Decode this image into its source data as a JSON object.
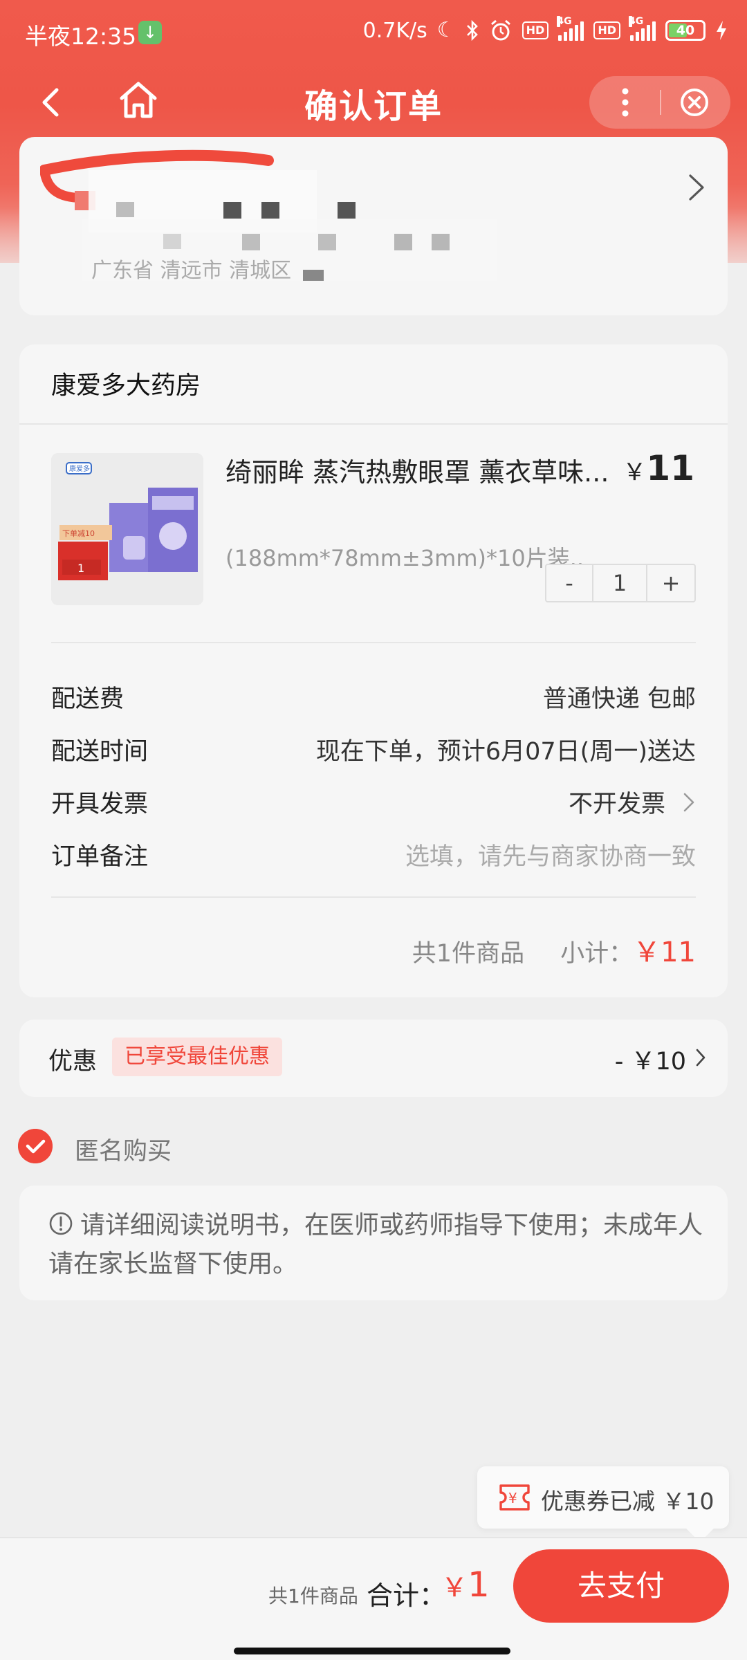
{
  "status_bar": {
    "time": "半夜12:35",
    "network_speed": "0.7K/s",
    "battery": "40",
    "icons": [
      "download-icon",
      "moon-icon",
      "bluetooth-icon",
      "alarm-icon",
      "hd-icon",
      "signal-4g-icon",
      "hd-icon",
      "signal-4g-icon",
      "battery-icon",
      "charging-icon"
    ]
  },
  "nav": {
    "title": "确认订单",
    "icons": [
      "back-icon",
      "home-icon",
      "more-icon",
      "close-icon"
    ]
  },
  "address": {
    "line": "广东省 清远市 清城区"
  },
  "shop": {
    "name": "康爱多大药房",
    "product": {
      "title": "绮丽眸 蒸汽热敷眼罩 薰衣草味...",
      "spec": "(188mm*78mm±3mm)*10片装...",
      "price_currency": "￥",
      "price": "11",
      "qty_minus": "-",
      "qty": "1",
      "qty_plus": "+",
      "image_badge": "下单减10",
      "image_brand": "康爱多"
    },
    "rows": [
      {
        "label": "配送费",
        "value": "普通快递 包邮"
      },
      {
        "label": "配送时间",
        "value": "现在下单，预计6月07日(周一)送达"
      },
      {
        "label": "开具发票",
        "value": "不开发票"
      },
      {
        "label": "订单备注",
        "placeholder": "选填，请先与商家协商一致"
      }
    ],
    "subtotal_count": "共1件商品",
    "subtotal_label": "小计：",
    "subtotal_value": "￥11"
  },
  "discount": {
    "label": "优惠",
    "tag": "已享受最佳优惠",
    "value": "- ￥10"
  },
  "anonymous": {
    "label": "匿名购买",
    "checked": true
  },
  "notice": {
    "text": "请详细阅读说明书，在医师或药师指导下使用；未成年人请在家长监督下使用。"
  },
  "coupon_bubble": {
    "text": "优惠券已减 ￥10"
  },
  "bottom": {
    "count": "共1件商品",
    "total_label": "合计：",
    "currency": "￥",
    "total": "1",
    "pay_button": "去支付"
  },
  "colors": {
    "accent": "#f0463a",
    "header": "#ef5547",
    "background": "#efefef"
  }
}
